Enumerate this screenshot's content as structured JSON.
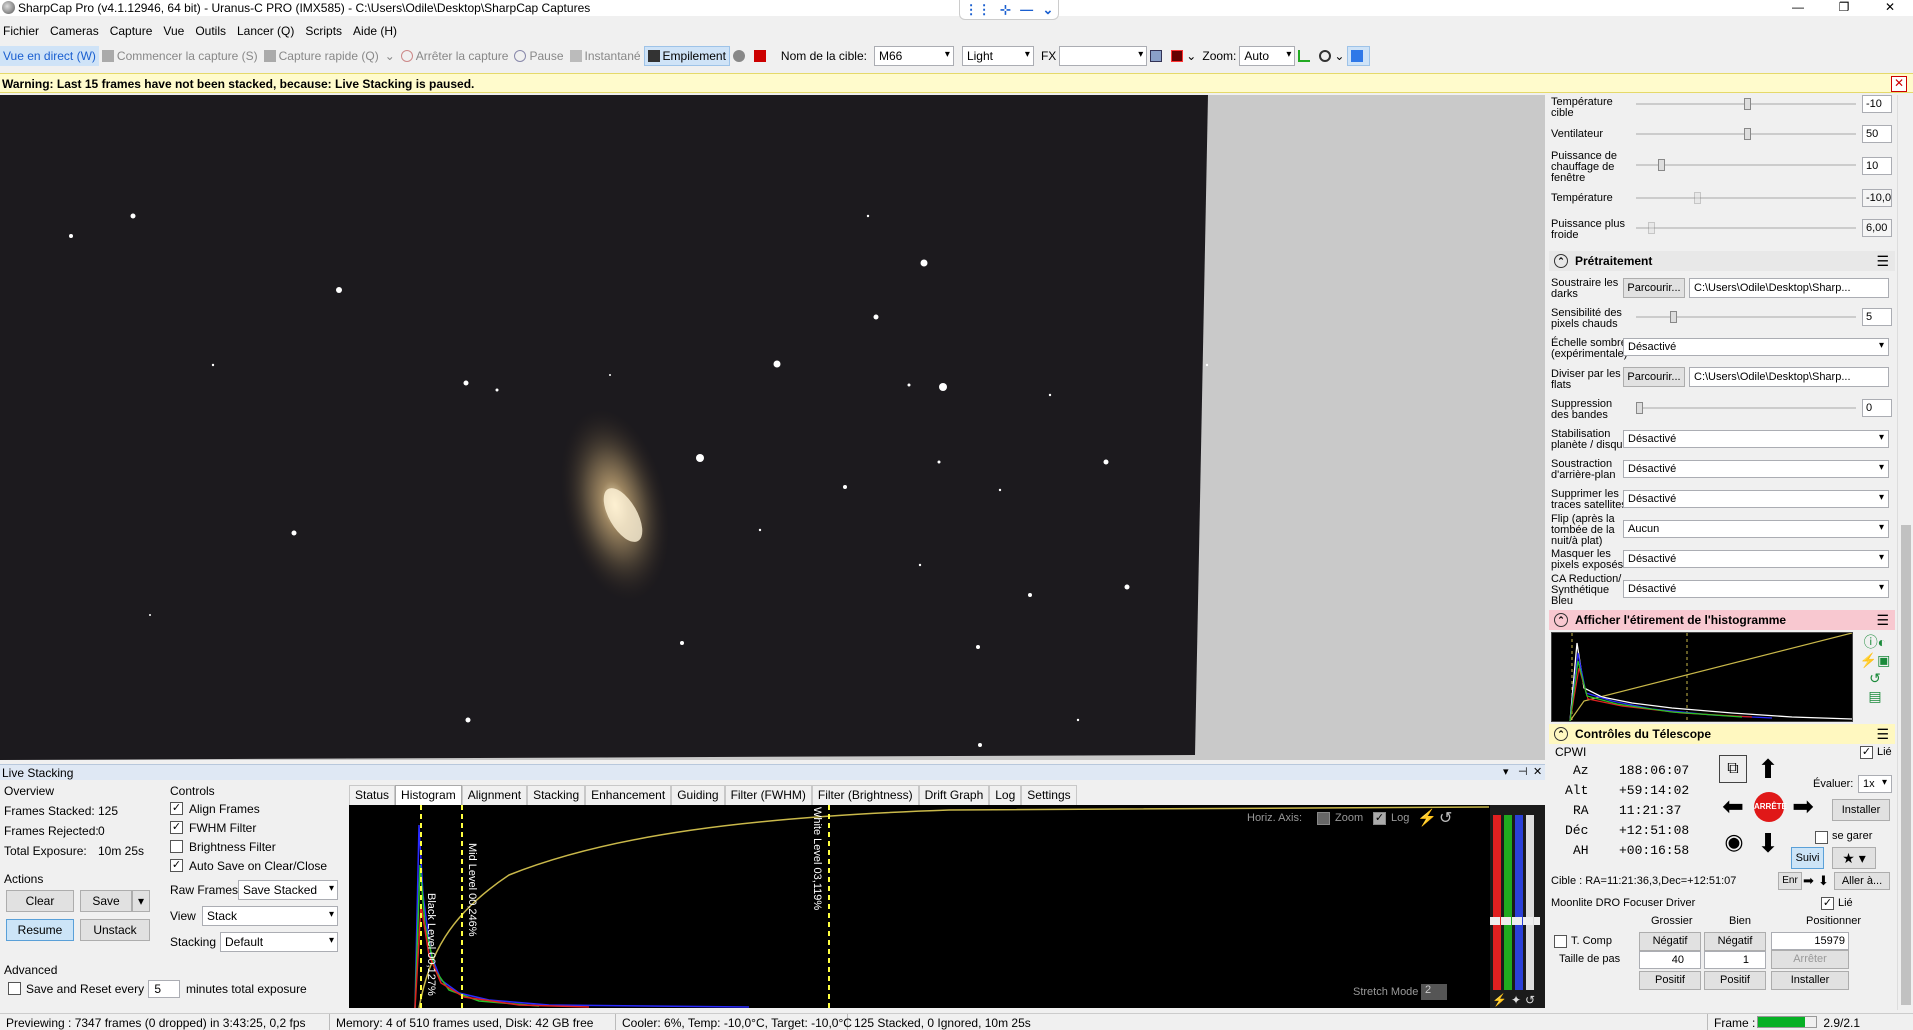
{
  "window": {
    "title": "SharpCap Pro (v4.1.12946, 64 bit) - Uranus-C PRO (IMX585) - C:\\Users\\Odile\\Desktop\\SharpCap Captures",
    "controls": [
      "—",
      "❐",
      "✕"
    ]
  },
  "menu": [
    "Fichier",
    "Cameras",
    "Capture",
    "Vue",
    "Outils",
    "Lancer (Q)",
    "Scripts",
    "Aide (H)"
  ],
  "toolbar": {
    "live_view": "Vue en direct (W)",
    "start_capture": "Commencer la capture (S)",
    "quick_capture": "Capture rapide (Q)",
    "stop_capture": "Arrêter la capture",
    "pause": "Pause",
    "snapshot": "Instantané",
    "stacking": "Empilement",
    "target_label": "Nom de la cible:",
    "target_value": "M66",
    "frame_type": "Light",
    "fx_label": "FX",
    "fx_value": "",
    "zoom_label": "Zoom:",
    "zoom_value": "Auto"
  },
  "warning": {
    "text": "Warning: Last 15 frames have not been stacked, because: Live Stacking is paused.",
    "close": "✕"
  },
  "live_stacking": {
    "panel_title": "Live Stacking",
    "overview_title": "Overview",
    "frames_stacked_label": "Frames Stacked:",
    "frames_stacked_value": "125",
    "frames_rejected_label": "Frames Rejected:",
    "frames_rejected_value": "0",
    "total_exposure_label": "Total Exposure:",
    "total_exposure_value": "10m 25s",
    "actions_title": "Actions",
    "clear": "Clear",
    "save": "Save",
    "resume": "Resume",
    "unstack": "Unstack",
    "controls_title": "Controls",
    "align_frames": "Align Frames",
    "fwhm_filter": "FWHM Filter",
    "brightness_filter": "Brightness Filter",
    "auto_save": "Auto Save on Clear/Close",
    "raw_frames_label": "Raw Frames",
    "raw_frames_value": "Save Stacked",
    "view_label": "View",
    "view_value": "Stack",
    "stacking_label": "Stacking",
    "stacking_value": "Default",
    "advanced_title": "Advanced",
    "save_reset_label": "Save and Reset every",
    "save_reset_value": "5",
    "save_reset_suffix": "minutes total exposure",
    "tabs": [
      "Status",
      "Histogram",
      "Alignment",
      "Stacking",
      "Enhancement",
      "Guiding",
      "Filter (FWHM)",
      "Filter (Brightness)",
      "Drift Graph",
      "Log",
      "Settings"
    ],
    "histogram": {
      "horiz_axis": "Horiz. Axis:",
      "zoom": "Zoom",
      "log": "Log",
      "black_level": "Black Level 00,127%",
      "mid_level": "Mid Level 00,246%",
      "white_level": "White Level 03,119%",
      "stretch_mode": "Stretch Mode",
      "stretch_value": "2"
    }
  },
  "right_panel": {
    "camera_rows": [
      {
        "label": "Température cible",
        "value": "-10"
      },
      {
        "label": "Ventilateur",
        "value": "50"
      },
      {
        "label": "Puissance de chauffage de fenêtre",
        "value": "10"
      },
      {
        "label": "Température",
        "value": "-10,0"
      },
      {
        "label": "Puissance plus froide",
        "value": "6,00"
      }
    ],
    "preprocessing": {
      "title": "Prétraitement",
      "darks_label": "Soustraire les darks",
      "browse": "Parcourir...",
      "darks_path": "C:\\Users\\Odile\\Desktop\\Sharp...",
      "hot_pixels_label": "Sensibilité des pixels chauds",
      "hot_pixels_value": "5",
      "dark_scale_label": "Échelle sombre (expérimentale)",
      "dark_scale_value": "Désactivé",
      "flats_label": "Diviser par les flats",
      "flats_path": "C:\\Users\\Odile\\Desktop\\Sharp...",
      "banding_label": "Suppression des bandes",
      "banding_value": "0",
      "stab_label": "Stabilisation planète / disque",
      "stab_value": "Désactivé",
      "bg_label": "Soustraction d'arrière-plan",
      "bg_value": "Désactivé",
      "sat_label": "Supprimer les traces satellites",
      "sat_value": "Désactivé",
      "flip_label": "Flip (après la tombée de la nuit/à plat)",
      "flip_value": "Aucun",
      "mask_label": "Masquer les pixels exposés",
      "mask_value": "Désactivé",
      "ca_label": "CA Reduction/ Synthétique Bleu",
      "ca_value": "Désactivé"
    },
    "histogram_stretch": {
      "title": "Afficher l'étirement de l'histogramme"
    },
    "telescope": {
      "title": "Contrôles du Télescope",
      "mount": "CPWI",
      "linked": "Lié",
      "az_label": "Az",
      "az_value": "188:06:07",
      "alt_label": "Alt",
      "alt_value": "+59:14:02",
      "ra_label": "RA",
      "ra_value": "11:21:37",
      "dec_label": "Déc",
      "dec_value": "+12:51:08",
      "ah_label": "AH",
      "ah_value": "+00:16:58",
      "rate_label": "Évaluer:",
      "rate_value": "1x",
      "install": "Installer",
      "park": "se garer",
      "stop": "ARRÊTE",
      "track": "Suivi",
      "target": "Cible : RA=11:21:36,3,Dec=+12:51:07",
      "enr": "Enr",
      "goto": "Aller à..."
    },
    "focuser": {
      "title": "Moonlite DRO Focuser Driver",
      "linked": "Lié",
      "coarse": "Grossier",
      "fine": "Bien",
      "position_label": "Positionner",
      "tcomp": "T. Comp",
      "negative": "Négatif",
      "position_value": "15979",
      "step_label": "Taille de pas",
      "step_coarse": "40",
      "step_fine": "1",
      "stop": "Arrêter",
      "positive": "Positif",
      "install": "Installer"
    }
  },
  "status_bar": {
    "preview": "Previewing : 7347 frames (0 dropped) in 3:43:25, 0,2 fps",
    "memory": "Memory: 4 of 510 frames used, Disk: 42 GB free",
    "cooler": "Cooler: 6%, Temp: -10,0°C, Target: -10,0°C",
    "stacked": "125 Stacked, 0 Ignored, 10m 25s",
    "frame_label": "Frame :",
    "frame_progress": 0.8,
    "ratio": "2.9/2.1"
  }
}
